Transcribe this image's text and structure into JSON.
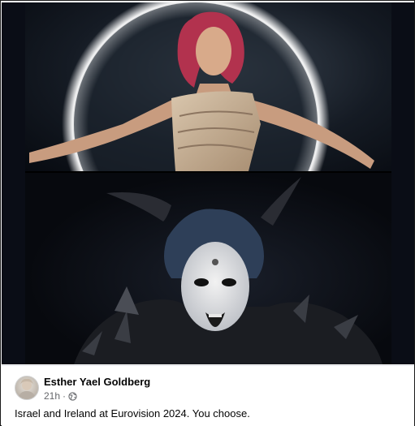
{
  "post": {
    "author": "Esther Yael Goldberg",
    "time": "21h",
    "separator": "·",
    "privacy_icon": "globe-icon",
    "caption": "Israel and Ireland at Eurovision 2024. You choose."
  },
  "media": {
    "top_photo": "performer-in-white-dress",
    "bottom_photo": "performer-with-horns-and-face-paint"
  },
  "colors": {
    "author_text": "#050505",
    "meta_text": "#65676b",
    "media_background": "#05070d"
  }
}
